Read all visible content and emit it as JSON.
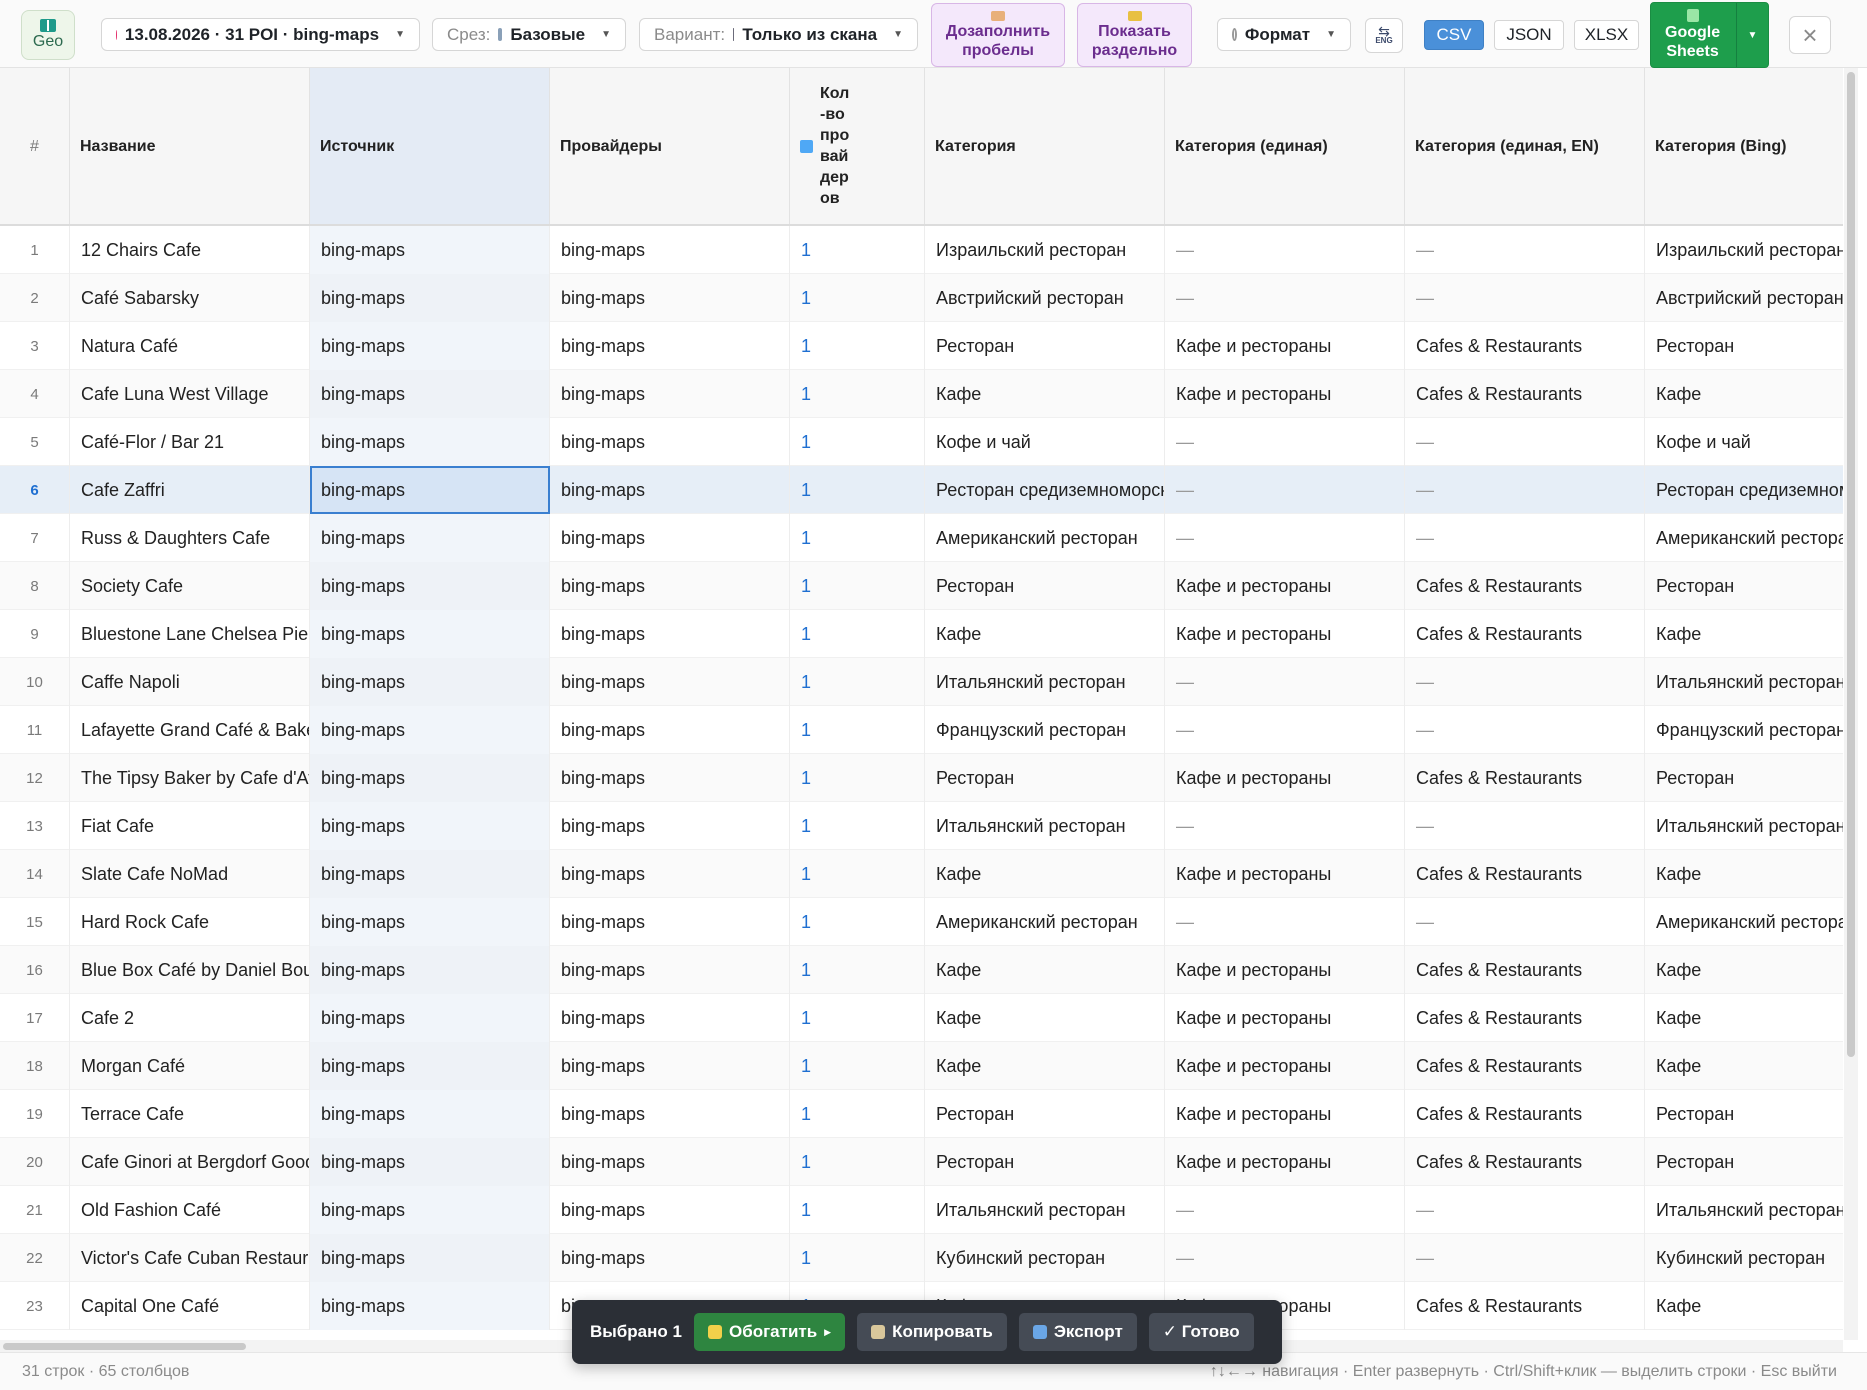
{
  "toolbar": {
    "geo_label": "Geo",
    "dataset_label": "13.08.2026 · 31 POI · bing-maps",
    "slice_prefix": "Срез:",
    "slice_value": "Базовые",
    "variant_prefix": "Вариант:",
    "variant_value": "Только из скана",
    "fill_gaps_line1": "Дозаполнить",
    "fill_gaps_line2": "пробелы",
    "show_separately_line1": "Показать",
    "show_separately_line2": "раздельно",
    "format_label": "Формат",
    "lang_label": "ENG",
    "csv_label": "CSV",
    "json_label": "JSON",
    "xlsx_label": "XLSX",
    "gsheets_line1": "Google",
    "gsheets_line2": "Sheets",
    "close_glyph": "×"
  },
  "columns": {
    "num": "#",
    "name": "Название",
    "source": "Источник",
    "providers": "Провайдеры",
    "count": "Кол-во провайдеров",
    "category": "Категория",
    "category_unified": "Категория (единая)",
    "category_unified_en": "Категория (единая, EN)",
    "category_bing": "Категория (Bing)"
  },
  "rows": [
    {
      "n": "1",
      "name": "12 Chairs Cafe",
      "source": "bing-maps",
      "providers": "bing-maps",
      "count": "1",
      "cat": "Израильский ресторан",
      "cat_u": "—",
      "cat_en": "—",
      "cat_bing": "Израильский ресторан"
    },
    {
      "n": "2",
      "name": "Café Sabarsky",
      "source": "bing-maps",
      "providers": "bing-maps",
      "count": "1",
      "cat": "Австрийский ресторан",
      "cat_u": "—",
      "cat_en": "—",
      "cat_bing": "Австрийский ресторан"
    },
    {
      "n": "3",
      "name": "Natura Café",
      "source": "bing-maps",
      "providers": "bing-maps",
      "count": "1",
      "cat": "Ресторан",
      "cat_u": "Кафе и рестораны",
      "cat_en": "Cafes & Restaurants",
      "cat_bing": "Ресторан"
    },
    {
      "n": "4",
      "name": "Cafe Luna West Village",
      "source": "bing-maps",
      "providers": "bing-maps",
      "count": "1",
      "cat": "Кафе",
      "cat_u": "Кафе и рестораны",
      "cat_en": "Cafes & Restaurants",
      "cat_bing": "Кафе"
    },
    {
      "n": "5",
      "name": "Café-Flor / Bar 21",
      "source": "bing-maps",
      "providers": "bing-maps",
      "count": "1",
      "cat": "Кофе и чай",
      "cat_u": "—",
      "cat_en": "—",
      "cat_bing": "Кофе и чай"
    },
    {
      "n": "6",
      "name": "Cafe Zaffri",
      "source": "bing-maps",
      "providers": "bing-maps",
      "count": "1",
      "cat": "Ресторан средиземноморской кухни",
      "cat_u": "—",
      "cat_en": "—",
      "cat_bing": "Ресторан средиземноморской кухни"
    },
    {
      "n": "7",
      "name": "Russ & Daughters Cafe",
      "source": "bing-maps",
      "providers": "bing-maps",
      "count": "1",
      "cat": "Американский ресторан",
      "cat_u": "—",
      "cat_en": "—",
      "cat_bing": "Американский ресторан"
    },
    {
      "n": "8",
      "name": "Society Cafe",
      "source": "bing-maps",
      "providers": "bing-maps",
      "count": "1",
      "cat": "Ресторан",
      "cat_u": "Кафе и рестораны",
      "cat_en": "Cafes & Restaurants",
      "cat_bing": "Ресторан"
    },
    {
      "n": "9",
      "name": "Bluestone Lane Chelsea Piers",
      "source": "bing-maps",
      "providers": "bing-maps",
      "count": "1",
      "cat": "Кафе",
      "cat_u": "Кафе и рестораны",
      "cat_en": "Cafes & Restaurants",
      "cat_bing": "Кафе"
    },
    {
      "n": "10",
      "name": "Caffe Napoli",
      "source": "bing-maps",
      "providers": "bing-maps",
      "count": "1",
      "cat": "Итальянский ресторан",
      "cat_u": "—",
      "cat_en": "—",
      "cat_bing": "Итальянский ресторан"
    },
    {
      "n": "11",
      "name": "Lafayette Grand Café & Bakery",
      "source": "bing-maps",
      "providers": "bing-maps",
      "count": "1",
      "cat": "Французский ресторан",
      "cat_u": "—",
      "cat_en": "—",
      "cat_bing": "Французский ресторан"
    },
    {
      "n": "12",
      "name": "The Tipsy Baker by Cafe d'Avignon",
      "source": "bing-maps",
      "providers": "bing-maps",
      "count": "1",
      "cat": "Ресторан",
      "cat_u": "Кафе и рестораны",
      "cat_en": "Cafes & Restaurants",
      "cat_bing": "Ресторан"
    },
    {
      "n": "13",
      "name": "Fiat Cafe",
      "source": "bing-maps",
      "providers": "bing-maps",
      "count": "1",
      "cat": "Итальянский ресторан",
      "cat_u": "—",
      "cat_en": "—",
      "cat_bing": "Итальянский ресторан"
    },
    {
      "n": "14",
      "name": "Slate Cafe NoMad",
      "source": "bing-maps",
      "providers": "bing-maps",
      "count": "1",
      "cat": "Кафе",
      "cat_u": "Кафе и рестораны",
      "cat_en": "Cafes & Restaurants",
      "cat_bing": "Кафе"
    },
    {
      "n": "15",
      "name": "Hard Rock Cafe",
      "source": "bing-maps",
      "providers": "bing-maps",
      "count": "1",
      "cat": "Американский ресторан",
      "cat_u": "—",
      "cat_en": "—",
      "cat_bing": "Американский ресторан"
    },
    {
      "n": "16",
      "name": "Blue Box Café by Daniel Boulud",
      "source": "bing-maps",
      "providers": "bing-maps",
      "count": "1",
      "cat": "Кафе",
      "cat_u": "Кафе и рестораны",
      "cat_en": "Cafes & Restaurants",
      "cat_bing": "Кафе"
    },
    {
      "n": "17",
      "name": "Cafe 2",
      "source": "bing-maps",
      "providers": "bing-maps",
      "count": "1",
      "cat": "Кафе",
      "cat_u": "Кафе и рестораны",
      "cat_en": "Cafes & Restaurants",
      "cat_bing": "Кафе"
    },
    {
      "n": "18",
      "name": "Morgan Café",
      "source": "bing-maps",
      "providers": "bing-maps",
      "count": "1",
      "cat": "Кафе",
      "cat_u": "Кафе и рестораны",
      "cat_en": "Cafes & Restaurants",
      "cat_bing": "Кафе"
    },
    {
      "n": "19",
      "name": "Terrace Cafe",
      "source": "bing-maps",
      "providers": "bing-maps",
      "count": "1",
      "cat": "Ресторан",
      "cat_u": "Кафе и рестораны",
      "cat_en": "Cafes & Restaurants",
      "cat_bing": "Ресторан"
    },
    {
      "n": "20",
      "name": "Cafe Ginori at Bergdorf Goodman",
      "source": "bing-maps",
      "providers": "bing-maps",
      "count": "1",
      "cat": "Ресторан",
      "cat_u": "Кафе и рестораны",
      "cat_en": "Cafes & Restaurants",
      "cat_bing": "Ресторан"
    },
    {
      "n": "21",
      "name": "Old Fashion Café",
      "source": "bing-maps",
      "providers": "bing-maps",
      "count": "1",
      "cat": "Итальянский ресторан",
      "cat_u": "—",
      "cat_en": "—",
      "cat_bing": "Итальянский ресторан"
    },
    {
      "n": "22",
      "name": "Victor's Cafe Cuban Restaurant",
      "source": "bing-maps",
      "providers": "bing-maps",
      "count": "1",
      "cat": "Кубинский ресторан",
      "cat_u": "—",
      "cat_en": "—",
      "cat_bing": "Кубинский ресторан"
    },
    {
      "n": "23",
      "name": "Capital One Café",
      "source": "bing-maps",
      "providers": "bing-maps",
      "count": "1",
      "cat": "Кафе",
      "cat_u": "Кафе и рестораны",
      "cat_en": "Cafes & Restaurants",
      "cat_bing": "Кафе"
    }
  ],
  "selection": {
    "active_row": "6",
    "active_column": "source"
  },
  "action_bar": {
    "selected_label": "Выбрано 1",
    "enrich_label": "Обогатить",
    "copy_label": "Копировать",
    "export_label": "Экспорт",
    "done_label": "✓ Готово"
  },
  "footer": {
    "summary": "31 строк · 65 столбцов",
    "hint": "↑↓←→ навигация · Enter развернуть · Ctrl/Shift+клик — выделить строки · Esc выйти"
  },
  "colors": {
    "accent_blue": "#4a90d9",
    "google_green": "#1e9e4c",
    "purple_bg": "#f4e8fb",
    "action_bar_bg": "#2b2f36"
  }
}
